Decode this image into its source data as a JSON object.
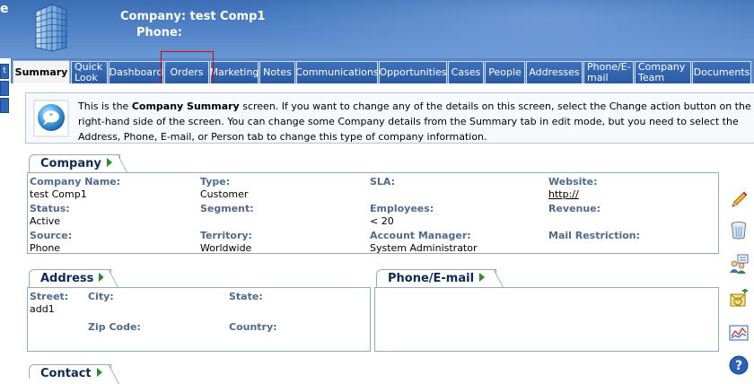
{
  "header": {
    "edge_glyph": "e",
    "company_line": "Company: test Comp1",
    "phone_line": "Phone:"
  },
  "rail": {
    "items": [
      "t",
      "",
      ""
    ]
  },
  "tabs": [
    {
      "label": "Summary",
      "active": true
    },
    {
      "label": "Quick Look",
      "line1": "Quick",
      "line2": "Look"
    },
    {
      "label": "Dashboard"
    },
    {
      "label": "Orders",
      "highlighted": true
    },
    {
      "label": "Marketing"
    },
    {
      "label": "Notes"
    },
    {
      "label": "Communications"
    },
    {
      "label": "Opportunities"
    },
    {
      "label": "Cases"
    },
    {
      "label": "People"
    },
    {
      "label": "Addresses"
    },
    {
      "label": "Phone/E-mail",
      "line1": "Phone/E-",
      "line2": "mail"
    },
    {
      "label": "Company Team",
      "line1": "Company",
      "line2": "Team"
    },
    {
      "label": "Documents"
    }
  ],
  "info": {
    "text_pre": "This is the ",
    "text_bold": "Company Summary",
    "text_post": " screen. If you want to change any of the details on this screen, select the Change action button on the right-hand side of the screen. You can change some Company details from the Summary tab in edit mode, but you need to select the Address, Phone, E-mail, or Person tab to change this type of company information."
  },
  "company_panel": {
    "title": "Company",
    "fields": {
      "company_name_label": "Company Name:",
      "company_name": "test Comp1",
      "type_label": "Type:",
      "type": "Customer",
      "sla_label": "SLA:",
      "sla": "",
      "website_label": "Website:",
      "website": "http://",
      "status_label": "Status:",
      "status": "Active",
      "segment_label": "Segment:",
      "segment": "",
      "employees_label": "Employees:",
      "employees": "< 20",
      "revenue_label": "Revenue:",
      "revenue": "",
      "source_label": "Source:",
      "source": "Phone",
      "territory_label": "Territory:",
      "territory": "Worldwide",
      "account_manager_label": "Account Manager:",
      "account_manager": "System Administrator",
      "mail_restriction_label": "Mail Restriction:",
      "mail_restriction": ""
    }
  },
  "address_panel": {
    "title": "Address",
    "street_label": "Street:",
    "street": "add1",
    "city_label": "City:",
    "state_label": "State:",
    "zip_label": "Zip Code:",
    "country_label": "Country:"
  },
  "phone_panel": {
    "title": "Phone/E-mail"
  },
  "contact_panel": {
    "title": "Contact"
  },
  "icons": {
    "building": "building-icon",
    "chat": "speech-bubble-icon",
    "actions": [
      "pencil-icon",
      "trash-icon",
      "people-list-icon",
      "email-add-icon",
      "chart-icon",
      "help-icon"
    ]
  },
  "colors": {
    "header_blue": "#4677bd",
    "tab_blue": "#2f62ad",
    "label_blue": "#506a8f",
    "highlight_red": "#e00000",
    "arrow_green": "#2b8a2b"
  }
}
